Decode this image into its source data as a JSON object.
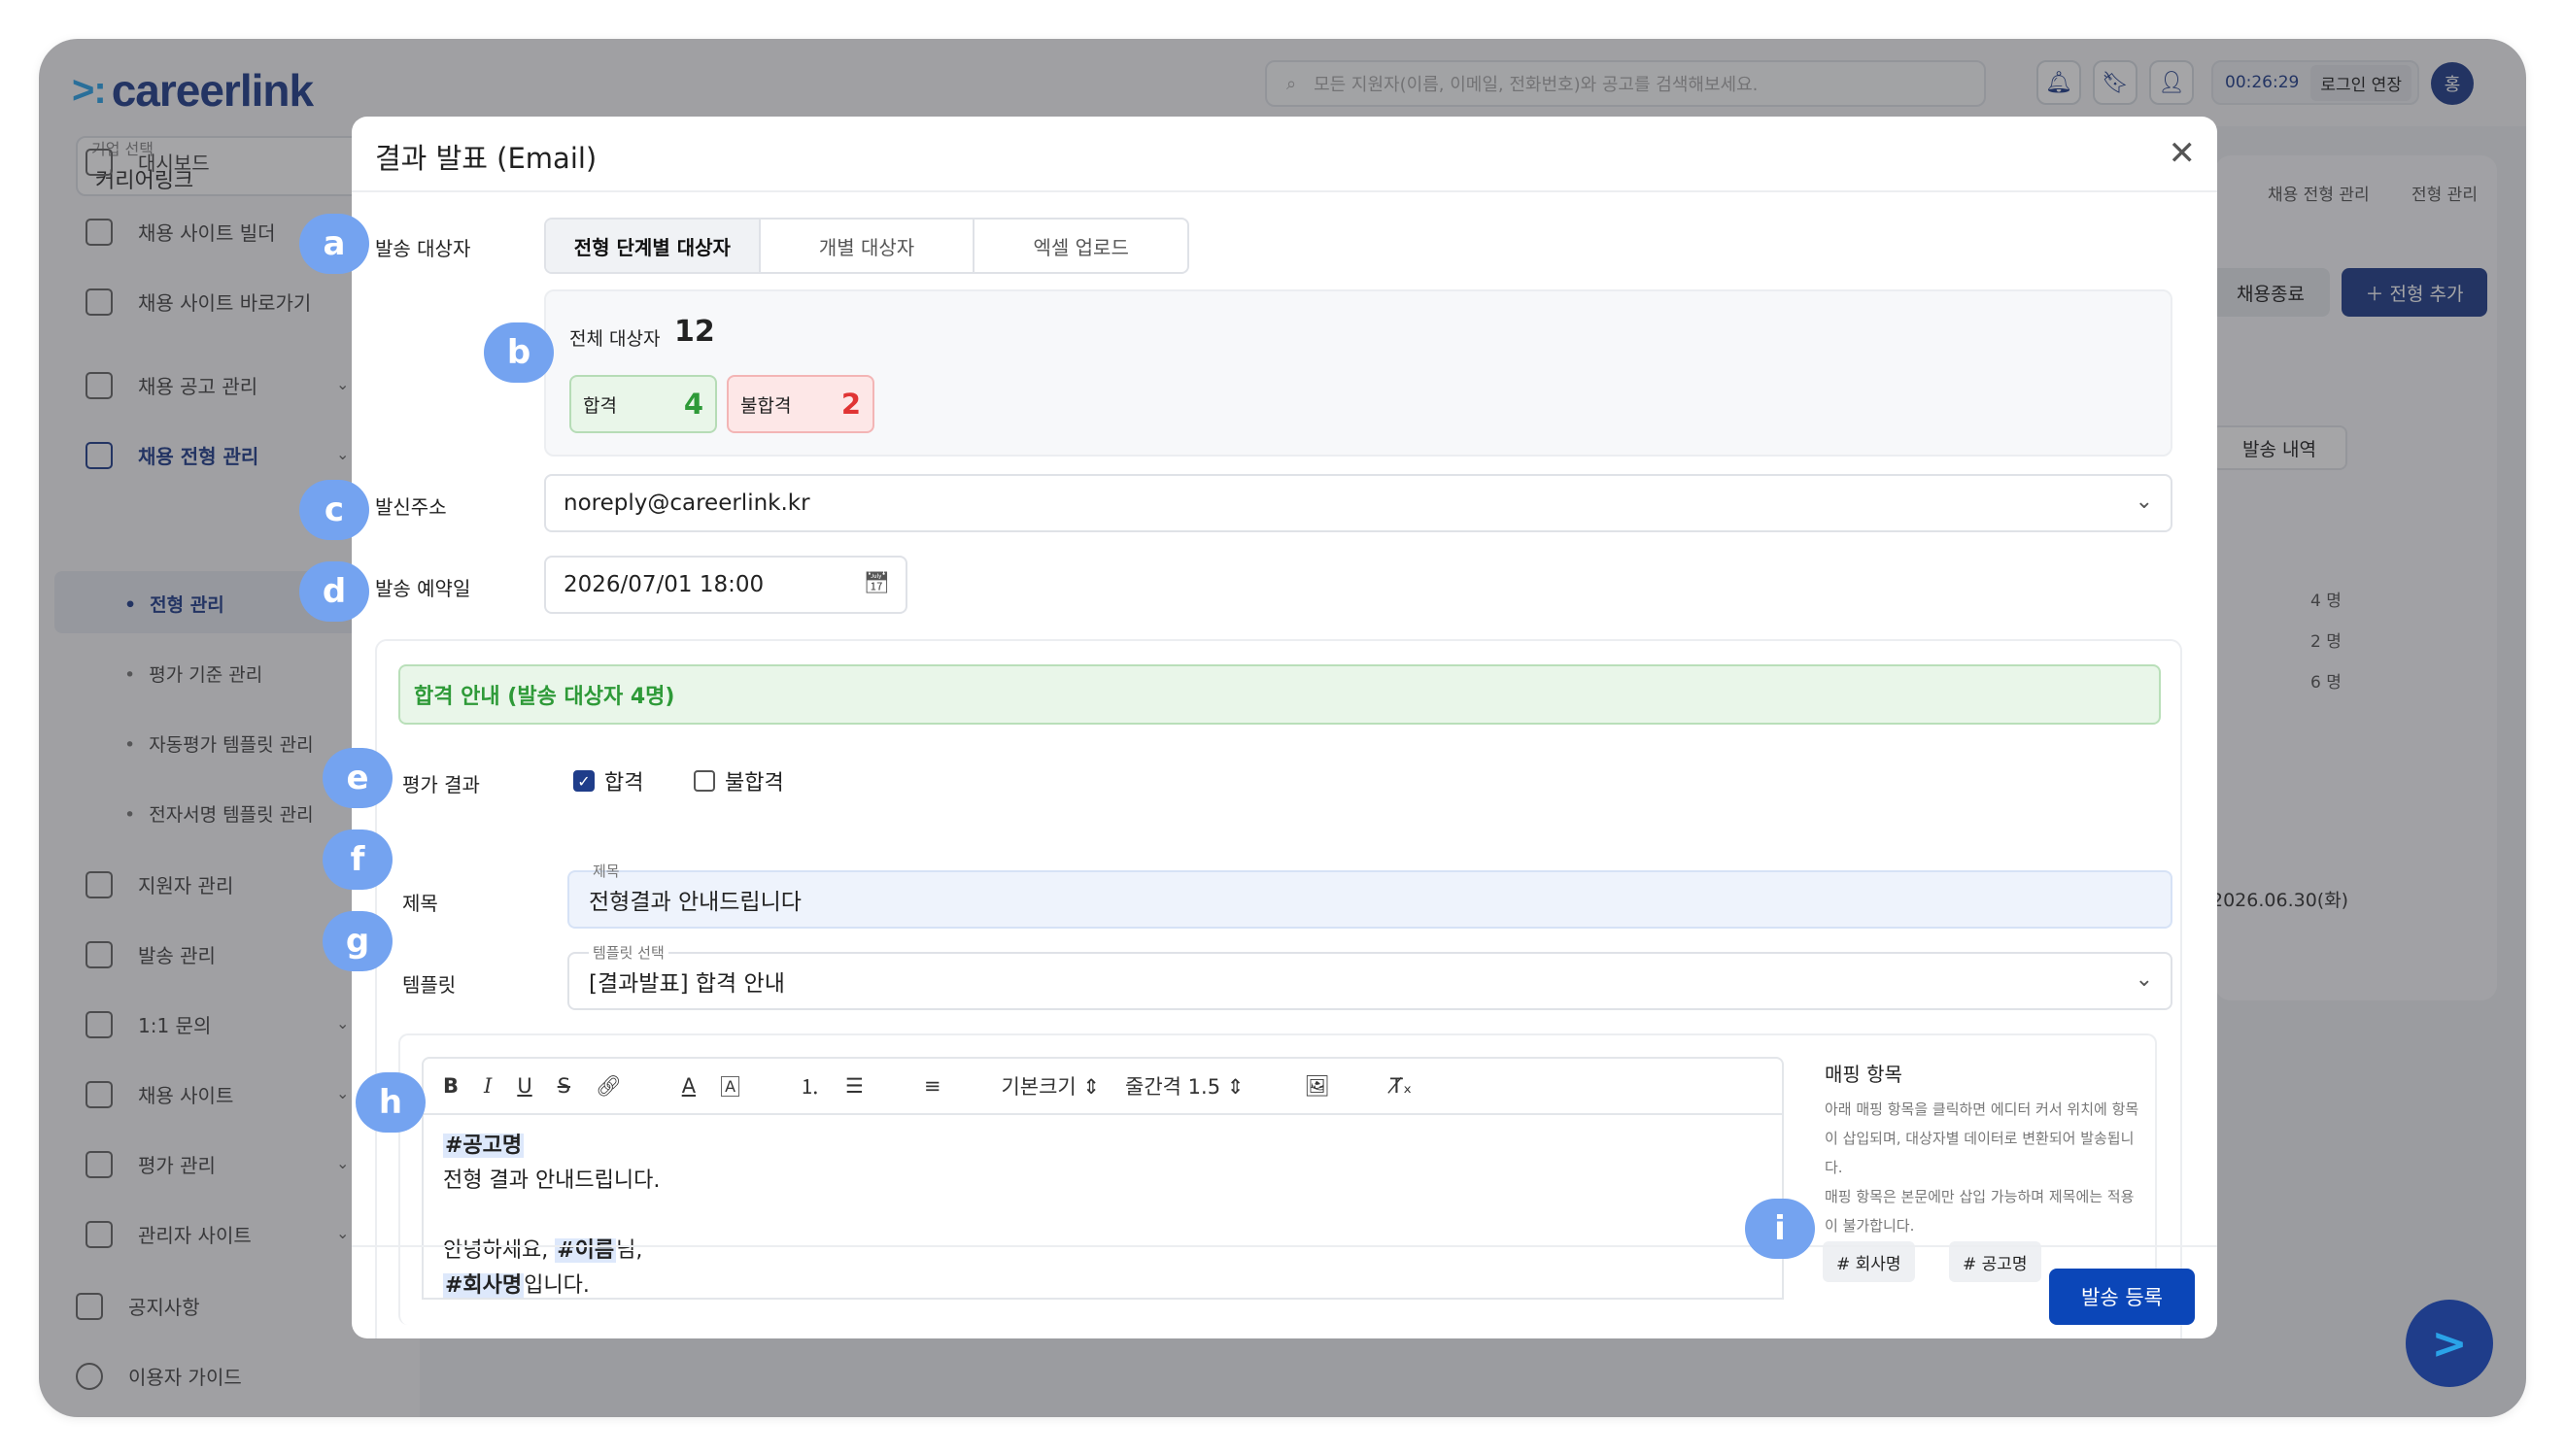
{
  "app": {
    "logo": "careerlink",
    "company_caption": "기업 선택",
    "company_name": "커리어링크",
    "search_placeholder": "모든 지원자(이름, 이메일, 전화번호)와 공고를 검색해보세요.",
    "timer": "00:26:29",
    "extend_login": "로그인 연장",
    "avatar": "홍"
  },
  "sidebar": {
    "items": [
      {
        "label": "대시보드"
      },
      {
        "label": "채용 사이트 빌더"
      },
      {
        "label": "채용 사이트 바로가기"
      },
      {
        "label": "채용 공고 관리"
      },
      {
        "label": "채용 전형 관리"
      },
      {
        "label": "지원자 관리"
      },
      {
        "label": "발송 관리"
      },
      {
        "label": "1:1 문의"
      },
      {
        "label": "채용 사이트"
      },
      {
        "label": "평가 관리"
      },
      {
        "label": "관리자 사이트"
      },
      {
        "label": "공지사항"
      },
      {
        "label": "이용자 가이드"
      }
    ],
    "sub_items": [
      {
        "label": "전형 관리"
      },
      {
        "label": "평가 기준 관리"
      },
      {
        "label": "자동평가 템플릿 관리"
      },
      {
        "label": "전자서명 템플릿 관리"
      }
    ]
  },
  "background": {
    "breadcrumb_1": "채용 전형 관리",
    "breadcrumb_2": "전형 관리",
    "close_recruit": "채용종료",
    "add_stage": "전형 추가",
    "send_history": "발송 내역",
    "stats": [
      "4 명",
      "2 명",
      "6 명"
    ],
    "date": "2026.06.30(화)"
  },
  "modal": {
    "title": "결과 발표 (Email)",
    "labels": {
      "target": "발송 대상자",
      "sender": "발신주소",
      "schedule": "발송 예약일",
      "eval_result": "평가 결과",
      "subject": "제목",
      "template": "템플릿"
    },
    "tabs": [
      "전형 단계별 대상자",
      "개별 대상자",
      "엑셀 업로드"
    ],
    "total_label": "전체 대상자",
    "total_count": "12",
    "pass_label": "합격",
    "pass_count": "4",
    "fail_label": "불합격",
    "fail_count": "2",
    "sender_email": "noreply@careerlink.kr",
    "schedule_date": "2026/07/01 18:00",
    "section_header": "합격 안내 (발송 대상자 4명)",
    "checkbox_pass": "합격",
    "checkbox_fail": "불합격",
    "subject_caption": "제목",
    "subject_value": "전형결과 안내드립니다",
    "template_caption": "템플릿 선택",
    "template_value": "[결과발표] 합격 안내",
    "toolbar": {
      "font_size": "기본크기",
      "line_height": "줄간격 1.5"
    },
    "body": {
      "line1_tag": "#공고명",
      "line2": "전형 결과 안내드립니다.",
      "line3_pre": "안녕하세요, ",
      "line3_tag": "#이름",
      "line3_post": "님,",
      "line4_tag": "#회사명",
      "line4_post": "입니다."
    },
    "mapping_title": "매핑 항목",
    "mapping_desc_1": "아래 매핑 항목을 클릭하면 에디터 커서 위치에 항목이 삽입되며, 대상자별 데이터로 변환되어 발송됩니다.",
    "mapping_desc_2": "매핑 항목은 본문에만 삽입 가능하며 제목에는 적용이 불가합니다.",
    "tags": [
      "# 회사명",
      "# 공고명"
    ],
    "submit": "발송 등록"
  },
  "badges": [
    "a",
    "b",
    "c",
    "d",
    "e",
    "f",
    "g",
    "h",
    "i"
  ],
  "colors": {
    "brand": "#1f3d8a",
    "primary_button": "#0b46b8",
    "pass_green": "#2e9a38",
    "fail_red": "#e03434",
    "badge": "#74a3f0"
  }
}
